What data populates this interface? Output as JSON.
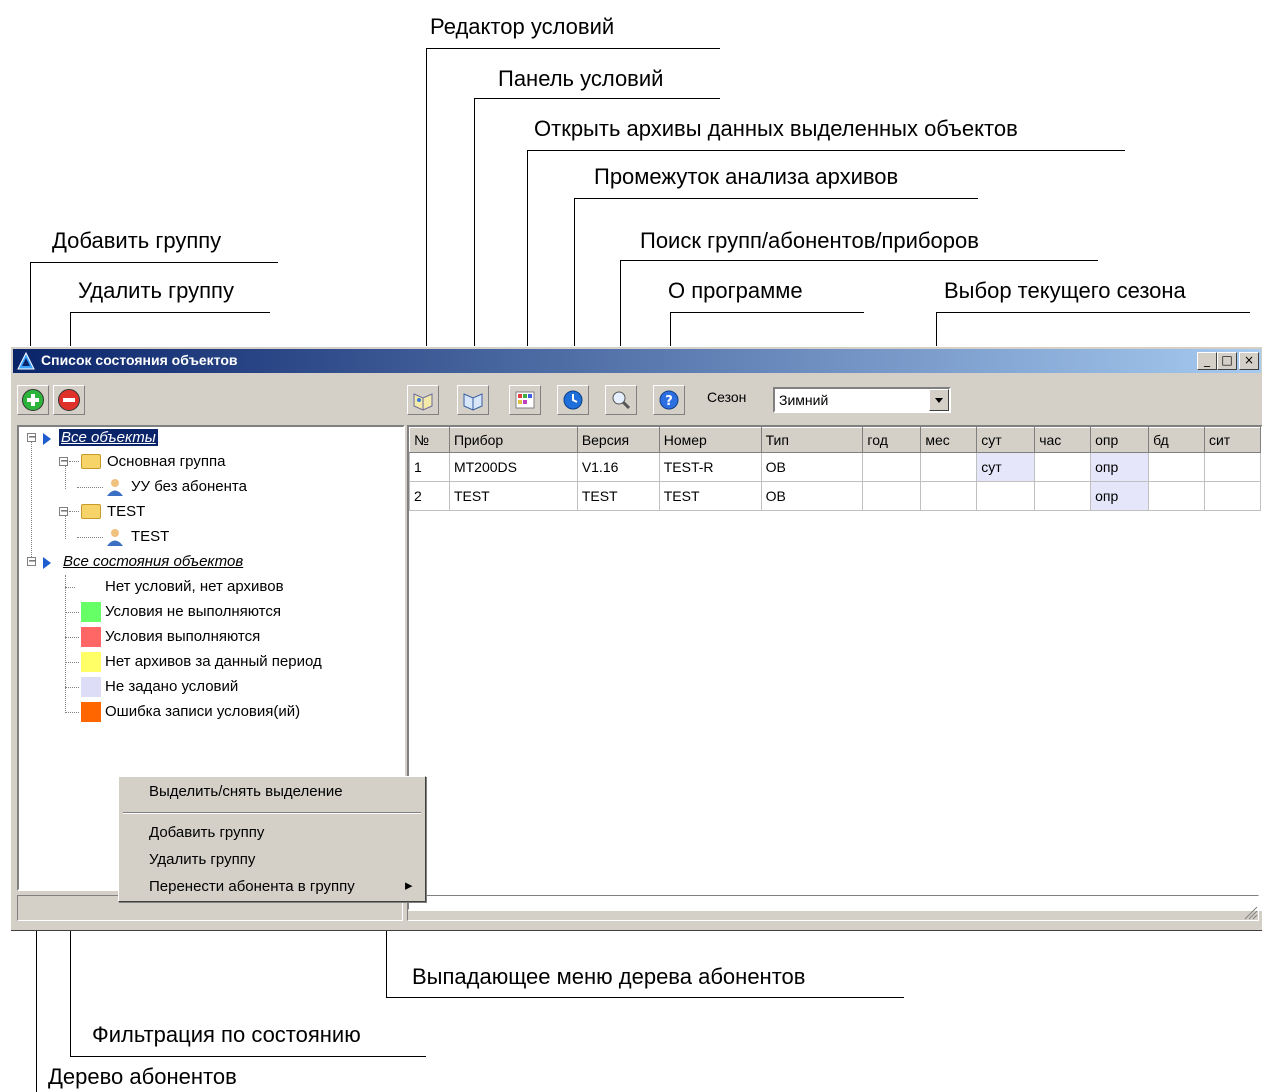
{
  "annotations": {
    "condition_editor": "Редактор условий",
    "condition_panel": "Панель условий",
    "open_archives": "Открыть архивы данных выделенных объектов",
    "archive_period": "Промежуток анализа архивов",
    "search": "Поиск групп/абонентов/приборов",
    "about": "О программе",
    "season_select": "Выбор текущего сезона",
    "add_group": "Добавить группу",
    "delete_group": "Удалить группу",
    "context_menu": "Выпадающее меню  дерева  абонентов",
    "state_filter": "Фильтрация по состоянию",
    "subscriber_tree": "Дерево абонентов"
  },
  "window": {
    "title": "Список состояния объектов",
    "minimize": "_",
    "maximize": "□",
    "close": "×"
  },
  "toolbar": {
    "season_label": "Сезон",
    "season_value": "Зимний",
    "icons": [
      "condition-editor-icon",
      "condition-panel-icon",
      "open-archives-icon",
      "archive-period-icon",
      "search-icon",
      "about-icon"
    ]
  },
  "tree": {
    "all_objects": "Все объекты",
    "groups": [
      {
        "name": "Основная группа",
        "child": "УУ без абонента"
      },
      {
        "name": "TEST",
        "child": "TEST"
      }
    ],
    "all_states": "Все состояния объектов",
    "states": [
      {
        "label": "Нет условий, нет архивов",
        "color": ""
      },
      {
        "label": "Условия не выполняются",
        "color": "#66ff66"
      },
      {
        "label": "Условия выполняются",
        "color": "#ff6666"
      },
      {
        "label": "Нет архивов за данный период",
        "color": "#ffff66"
      },
      {
        "label": "Не задано условий",
        "color": "#ddddf7"
      },
      {
        "label": "Ошибка записи условия(ий)",
        "color": "#ff6600"
      }
    ]
  },
  "table": {
    "columns": [
      "№",
      "Прибор",
      "Версия",
      "Номер",
      "Тип",
      "год",
      "мес",
      "сут",
      "час",
      "опр",
      "бд",
      "сит"
    ],
    "rows": [
      [
        "1",
        "MT200DS",
        "V1.16",
        "TEST-R",
        "OB",
        "",
        "",
        "сут",
        "",
        "опр",
        "",
        ""
      ],
      [
        "2",
        "TEST",
        "TEST",
        "TEST",
        "OB",
        "",
        "",
        "",
        "",
        "опр",
        "",
        ""
      ]
    ]
  },
  "context_menu": {
    "items": [
      "Выделить/снять выделение",
      "Добавить группу",
      "Удалить группу",
      "Перенести абонента в группу"
    ],
    "submenu_arrow": "▸"
  }
}
